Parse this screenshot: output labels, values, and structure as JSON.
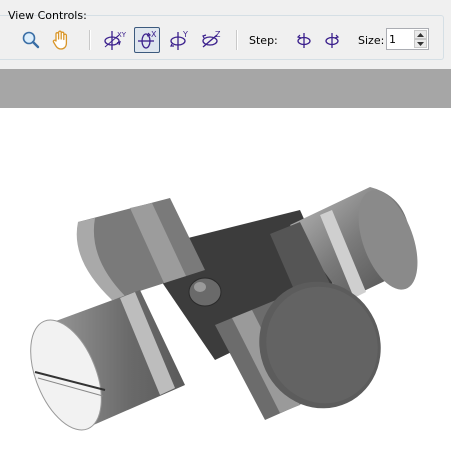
{
  "view_controls": {
    "title": "View Controls:",
    "tools": [
      {
        "name": "zoom",
        "icon": "magnifier-icon"
      },
      {
        "name": "pan",
        "icon": "hand-icon"
      },
      {
        "name": "rotate-xyz",
        "icon": "rotate-xyz-icon"
      },
      {
        "name": "rotate-x",
        "icon": "rotate-x-icon",
        "active": true
      },
      {
        "name": "rotate-y",
        "icon": "rotate-y-icon"
      },
      {
        "name": "rotate-z",
        "icon": "rotate-z-icon"
      }
    ],
    "axis_labels": {
      "xyz": "XYZ",
      "x": "X",
      "y": "Y",
      "z": "Z"
    },
    "step_label": "Step:",
    "size_label": "Size:",
    "size_value": "1"
  },
  "colors": {
    "panel_bg": "#f0f0f0",
    "band_gray": "#a6a6a6",
    "icon_purple": "#3a1f8c",
    "hand_orange": "#d9962a",
    "model_mid": "#7a7a7a",
    "model_dark": "#3a3a3a",
    "model_light": "#cfcfcf"
  }
}
